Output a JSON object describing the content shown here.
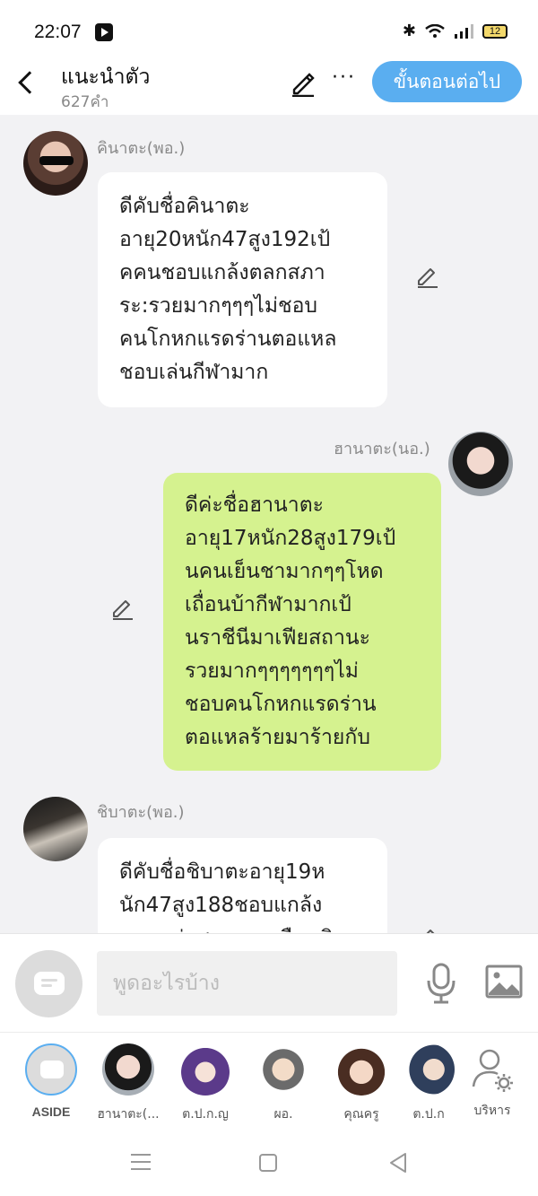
{
  "status": {
    "time": "22:07",
    "battery": "12"
  },
  "header": {
    "title": "แนะนำตัว",
    "word_count": "627คำ",
    "next_label": "ขั้นตอนต่อไป",
    "more": "···"
  },
  "messages": [
    {
      "sender": "คินาตะ(พอ.)",
      "side": "left",
      "text": "ดีคับชื่อคินาตะ\nอายุ20หนัก47สูง192เป้\nคคนชอบแกล้งตลกสภา\nระ:รวยมากๆๆๆไม่ชอบ\nคนโกหกแรดร่านตอแหล\nชอบเล่นกีฬามาก"
    },
    {
      "sender": "ฮานาตะ(นอ.)",
      "side": "right",
      "text": "ดีค่ะชื่อฮานาตะ\nอายุ17หนัก28สูง179เป้\nนคนเย็นชามากๆๆโหด\nเถื่อนบ้ากีฬามากเป้\nนราชีนีมาเฟียสถานะ\nรวยมากๆๆๆๆๆๆๆไม่\nชอบคนโกหกแรดร่าน\nตอแหลร้ายมาร้ายกับ"
    },
    {
      "sender": "ชิบาตะ(พอ.)",
      "side": "left",
      "text": "ดีคับชื่อชิบาตะอายุ19ห\nนัก47สูง188ชอบแกล้ง\nตลกหล่อสถานะเหมือนคิ"
    }
  ],
  "input": {
    "placeholder": "พูดอะไรบ้าง"
  },
  "tabs": [
    {
      "label": "ASIDE"
    },
    {
      "label": "ฮานาตะ(..."
    },
    {
      "label": "ต.ป.ก.ญ"
    },
    {
      "label": "ผอ."
    },
    {
      "label": "คุณครู"
    },
    {
      "label": "ต.ป.ก"
    },
    {
      "label": "บริหาร"
    }
  ],
  "colors": {
    "accent": "#5aaef0",
    "right_bubble": "#d5f28f",
    "left_bubble": "#ffffff",
    "background": "#f2f2f4"
  },
  "icons": [
    "back-icon",
    "edit-icon",
    "more-icon",
    "pencil-icon",
    "chat-mode-icon",
    "mic-icon",
    "image-icon",
    "admin-gear-icon",
    "nav-menu-icon",
    "nav-home-icon",
    "nav-back-icon"
  ]
}
